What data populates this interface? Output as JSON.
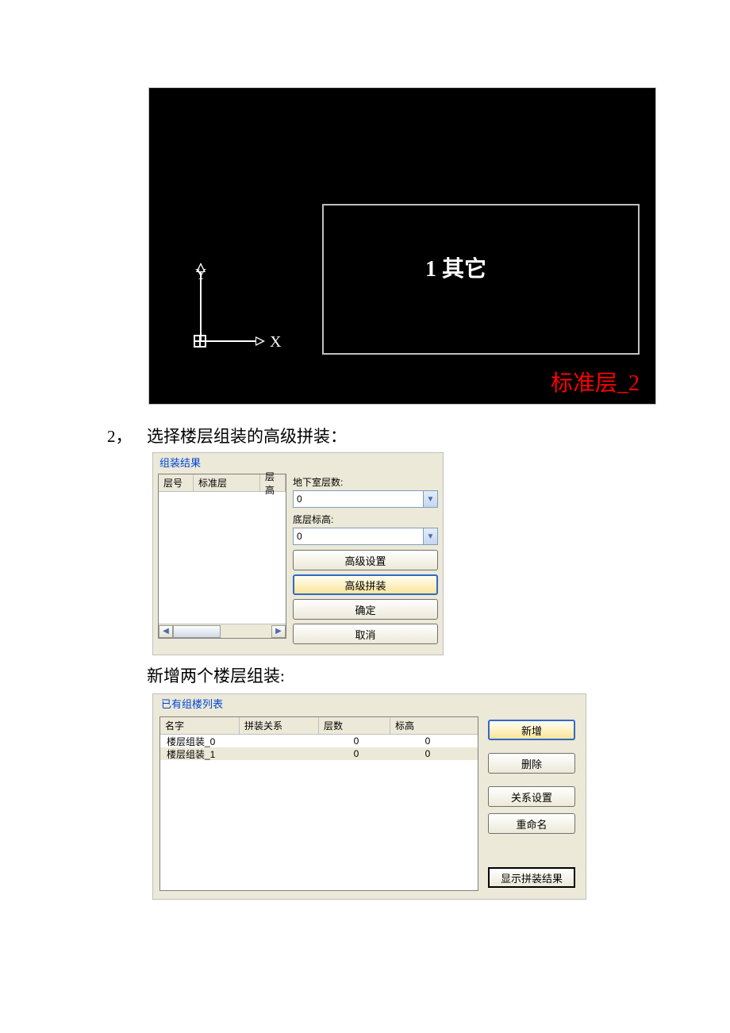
{
  "cad": {
    "y_label": "Y",
    "x_label": "X",
    "box_label": "1 其它",
    "red_label": "标准层_2"
  },
  "step2": {
    "num": "2，",
    "text": "选择楼层组装的高级拼装："
  },
  "dialog1": {
    "group_title": "组装结果",
    "col1": "层号",
    "col2": "标准层",
    "col3": "层高",
    "basement_label": "地下室层数:",
    "basement_value": "0",
    "base_elev_label": "底层标高:",
    "base_elev_value": "0",
    "btn_adv_settings": "高级设置",
    "btn_adv_assemble": "高级拼装",
    "btn_ok": "确定",
    "btn_cancel": "取消"
  },
  "caption2": "新增两个楼层组装:",
  "dialog2": {
    "group_title": "已有组楼列表",
    "col_name": "名字",
    "col_rel": "拼装关系",
    "col_cnt": "层数",
    "col_elev": "标高",
    "rows": [
      {
        "name": "楼层组装_0",
        "rel": "",
        "cnt": "0",
        "elev": "0"
      },
      {
        "name": "楼层组装_1",
        "rel": "",
        "cnt": "0",
        "elev": "0"
      }
    ],
    "btn_add": "新增",
    "btn_del": "删除",
    "btn_rel": "关系设置",
    "btn_rename": "重命名",
    "btn_showresult": "显示拼装结果"
  }
}
